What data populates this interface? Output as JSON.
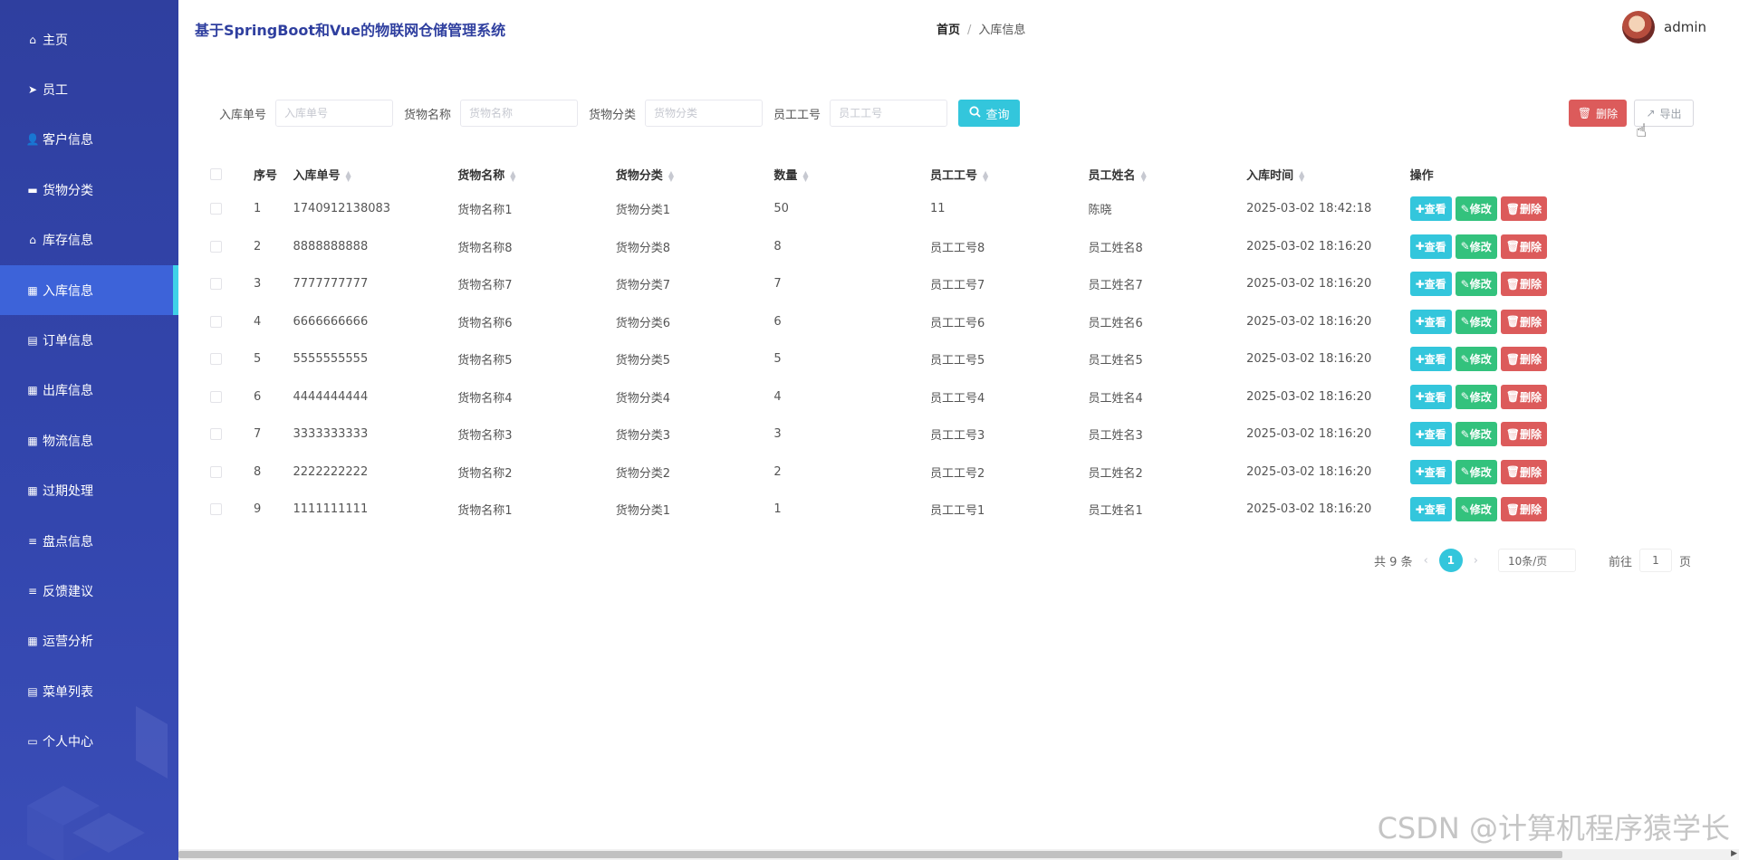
{
  "app_title": "基于SpringBoot和Vue的物联网仓储管理系统",
  "sidebar": {
    "items": [
      {
        "label": "主页",
        "icon": "home-icon"
      },
      {
        "label": "员工",
        "icon": "send-icon"
      },
      {
        "label": "客户信息",
        "icon": "user-icon"
      },
      {
        "label": "货物分类",
        "icon": "briefcase-icon"
      },
      {
        "label": "库存信息",
        "icon": "house-icon"
      },
      {
        "label": "入库信息",
        "icon": "grid-icon",
        "active": true
      },
      {
        "label": "订单信息",
        "icon": "clipboard-icon"
      },
      {
        "label": "出库信息",
        "icon": "grid-icon"
      },
      {
        "label": "物流信息",
        "icon": "grid-icon"
      },
      {
        "label": "过期处理",
        "icon": "grid-icon"
      },
      {
        "label": "盘点信息",
        "icon": "list-icon"
      },
      {
        "label": "反馈建议",
        "icon": "list-icon"
      },
      {
        "label": "运营分析",
        "icon": "grid-icon"
      },
      {
        "label": "菜单列表",
        "icon": "table-icon"
      },
      {
        "label": "个人中心",
        "icon": "card-icon"
      }
    ]
  },
  "breadcrumb": {
    "home": "首页",
    "separator": "/",
    "current": "入库信息"
  },
  "user": {
    "name": "admin"
  },
  "search": {
    "fields": [
      {
        "label": "入库单号",
        "placeholder": "入库单号"
      },
      {
        "label": "货物名称",
        "placeholder": "货物名称"
      },
      {
        "label": "货物分类",
        "placeholder": "货物分类"
      },
      {
        "label": "员工工号",
        "placeholder": "员工工号"
      }
    ],
    "query_label": "查询"
  },
  "toolbar": {
    "delete_label": "删除",
    "export_label": "导出"
  },
  "table": {
    "headers": [
      "序号",
      "入库单号",
      "货物名称",
      "货物分类",
      "数量",
      "员工工号",
      "员工姓名",
      "入库时间",
      "操作"
    ],
    "rows": [
      {
        "no": "1",
        "order": "1740912138083",
        "name": "货物名称1",
        "category": "货物分类1",
        "qty": "50",
        "emp_id": "11",
        "emp_name": "陈晓",
        "time": "2025-03-02 18:42:18"
      },
      {
        "no": "2",
        "order": "8888888888",
        "name": "货物名称8",
        "category": "货物分类8",
        "qty": "8",
        "emp_id": "员工工号8",
        "emp_name": "员工姓名8",
        "time": "2025-03-02 18:16:20"
      },
      {
        "no": "3",
        "order": "7777777777",
        "name": "货物名称7",
        "category": "货物分类7",
        "qty": "7",
        "emp_id": "员工工号7",
        "emp_name": "员工姓名7",
        "time": "2025-03-02 18:16:20"
      },
      {
        "no": "4",
        "order": "6666666666",
        "name": "货物名称6",
        "category": "货物分类6",
        "qty": "6",
        "emp_id": "员工工号6",
        "emp_name": "员工姓名6",
        "time": "2025-03-02 18:16:20"
      },
      {
        "no": "5",
        "order": "5555555555",
        "name": "货物名称5",
        "category": "货物分类5",
        "qty": "5",
        "emp_id": "员工工号5",
        "emp_name": "员工姓名5",
        "time": "2025-03-02 18:16:20"
      },
      {
        "no": "6",
        "order": "4444444444",
        "name": "货物名称4",
        "category": "货物分类4",
        "qty": "4",
        "emp_id": "员工工号4",
        "emp_name": "员工姓名4",
        "time": "2025-03-02 18:16:20"
      },
      {
        "no": "7",
        "order": "3333333333",
        "name": "货物名称3",
        "category": "货物分类3",
        "qty": "3",
        "emp_id": "员工工号3",
        "emp_name": "员工姓名3",
        "time": "2025-03-02 18:16:20"
      },
      {
        "no": "8",
        "order": "2222222222",
        "name": "货物名称2",
        "category": "货物分类2",
        "qty": "2",
        "emp_id": "员工工号2",
        "emp_name": "员工姓名2",
        "time": "2025-03-02 18:16:20"
      },
      {
        "no": "9",
        "order": "1111111111",
        "name": "货物名称1",
        "category": "货物分类1",
        "qty": "1",
        "emp_id": "员工工号1",
        "emp_name": "员工姓名1",
        "time": "2025-03-02 18:16:20"
      }
    ],
    "actions": {
      "view": "查看",
      "edit": "修改",
      "delete": "删除"
    }
  },
  "pagination": {
    "total_text": "共 9 条",
    "current_page": "1",
    "page_size": "10条/页",
    "goto_prefix": "前往",
    "goto_value": "1",
    "goto_suffix": "页"
  },
  "watermark": "CSDN @计算机程序猿学长",
  "colors": {
    "sidebar": "#3346ae",
    "active_item": "#3d63d9",
    "accent_cyan": "#33c6dc",
    "success_green": "#33c27d",
    "danger_red": "#dc5b5b"
  }
}
